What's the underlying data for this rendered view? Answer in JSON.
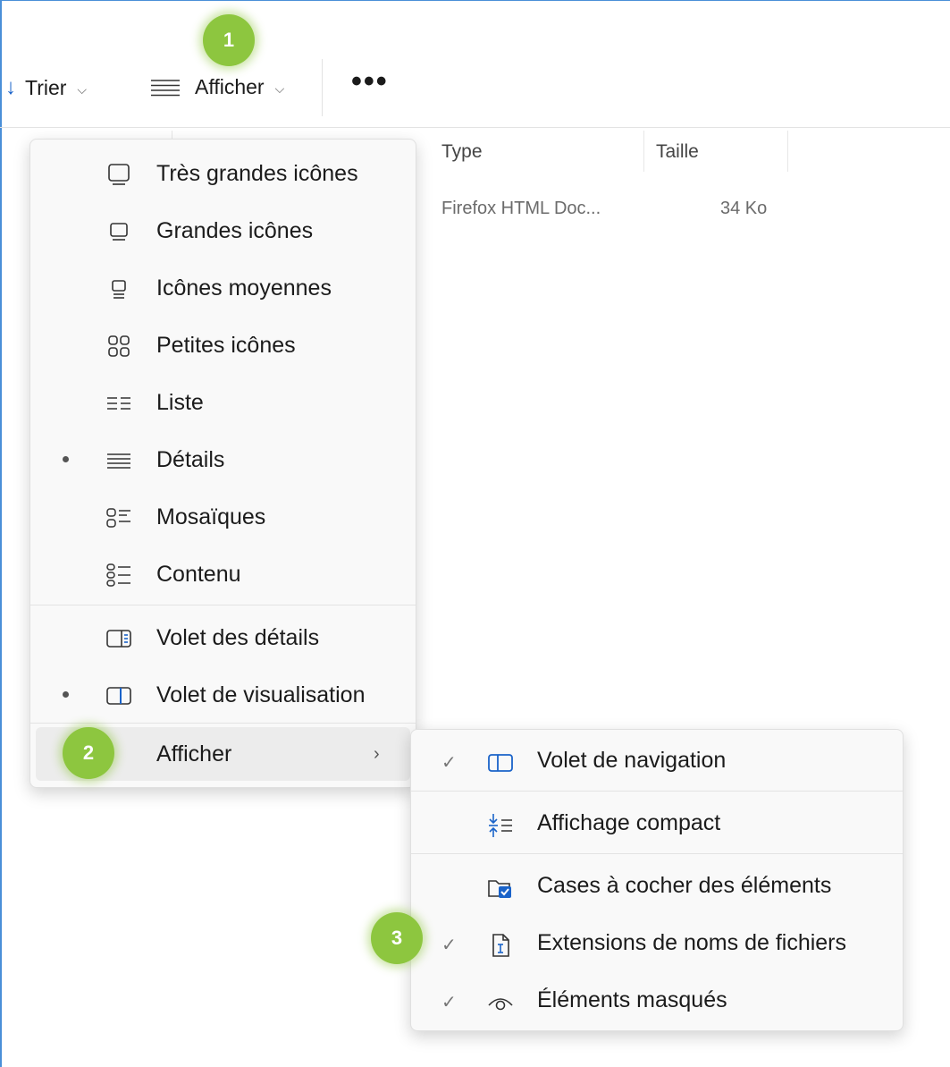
{
  "toolbar": {
    "sort_label": "Trier",
    "view_label": "Afficher",
    "more_label": "•••"
  },
  "columns": {
    "type": "Type",
    "size": "Taille"
  },
  "file_row": {
    "type": "Firefox HTML Doc...",
    "size": "34 Ko"
  },
  "badges": [
    "1",
    "2",
    "3"
  ],
  "view_menu": {
    "items": [
      {
        "label": "Très grandes icônes",
        "icon": "monitor-xl-icon",
        "selected": false
      },
      {
        "label": "Grandes icônes",
        "icon": "monitor-large-icon",
        "selected": false
      },
      {
        "label": "Icônes moyennes",
        "icon": "monitor-medium-icon",
        "selected": false
      },
      {
        "label": "Petites icônes",
        "icon": "small-grid-icon",
        "selected": false
      },
      {
        "label": "Liste",
        "icon": "list-icon",
        "selected": false
      },
      {
        "label": "Détails",
        "icon": "details-icon",
        "selected": true
      },
      {
        "label": "Mosaïques",
        "icon": "tiles-icon",
        "selected": false
      },
      {
        "label": "Contenu",
        "icon": "content-icon",
        "selected": false
      }
    ],
    "panes": [
      {
        "label": "Volet des détails",
        "icon": "details-pane-icon",
        "selected": false
      },
      {
        "label": "Volet de visualisation",
        "icon": "preview-pane-icon",
        "selected": true
      }
    ],
    "show_label": "Afficher",
    "show_arrow": "›"
  },
  "show_submenu": {
    "items": [
      {
        "label": "Volet de navigation",
        "icon": "navigation-pane-icon",
        "checked": true
      },
      {
        "label": "Affichage compact",
        "icon": "compact-view-icon",
        "checked": false
      },
      {
        "label": "Cases à cocher des éléments",
        "icon": "checkbox-folder-icon",
        "checked": false
      },
      {
        "label": "Extensions de noms de fichiers",
        "icon": "file-extension-icon",
        "checked": true
      },
      {
        "label": "Éléments masqués",
        "icon": "eye-icon",
        "checked": true
      }
    ],
    "check_mark": "✓"
  },
  "colors": {
    "accent": "#1a63c9",
    "badge": "#8dc63f",
    "window_border": "#4a8fd8"
  }
}
